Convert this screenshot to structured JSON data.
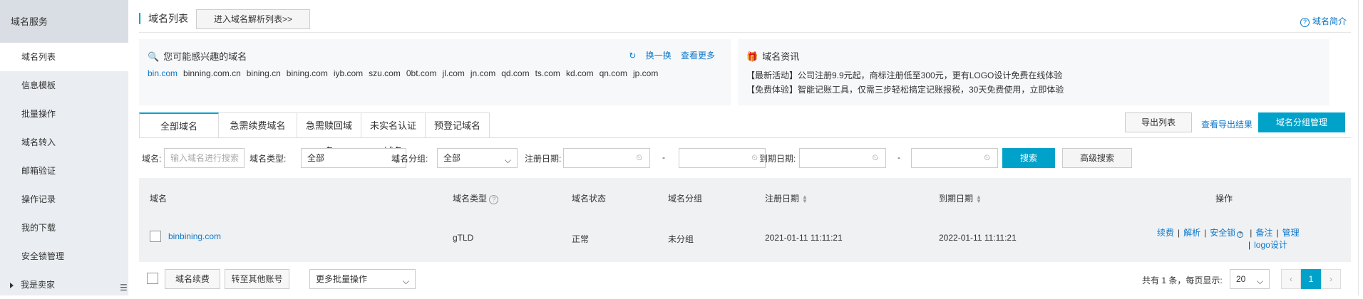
{
  "sidebar": {
    "title": "域名服务",
    "items": [
      {
        "label": "域名列表"
      },
      {
        "label": "信息模板"
      },
      {
        "label": "批量操作"
      },
      {
        "label": "域名转入"
      },
      {
        "label": "邮箱验证"
      },
      {
        "label": "操作记录"
      },
      {
        "label": "我的下载"
      },
      {
        "label": "安全锁管理"
      },
      {
        "label": "我是卖家"
      }
    ]
  },
  "header": {
    "title": "域名列表",
    "goto_label": "进入域名解析列表>>",
    "intro_link": "域名简介"
  },
  "suggest": {
    "title": "您可能感兴趣的域名",
    "refresh": "换一换",
    "more": "查看更多",
    "domains": [
      "bin.com",
      "binning.com.cn",
      "bining.cn",
      "bining.com",
      "iyb.com",
      "szu.com",
      "0bt.com",
      "jl.com",
      "jn.com",
      "qd.com",
      "ts.com",
      "kd.com",
      "qn.com",
      "jp.com"
    ]
  },
  "news": {
    "title": "域名资讯",
    "lines": [
      "【最新活动】公司注册9.9元起，商标注册低至300元，更有LOGO设计免费在线体验",
      "【免费体验】智能记账工具，仅需三步轻松搞定记账报税，30天免费使用，立即体验"
    ]
  },
  "tabs": [
    "全部域名",
    "急需续费域名",
    "急需赎回域名",
    "未实名认证域名",
    "预登记域名"
  ],
  "toolbar": {
    "export": "导出列表",
    "export_result": "查看导出结果",
    "group_manage": "域名分组管理"
  },
  "filter": {
    "domain_label": "域名:",
    "domain_placeholder": "输入域名进行搜索",
    "type_label": "域名类型:",
    "type_value": "全部",
    "group_label": "域名分组:",
    "group_value": "全部",
    "reg_label": "注册日期:",
    "exp_label": "到期日期:",
    "dash": "-",
    "search": "搜索",
    "advanced": "高级搜索"
  },
  "table": {
    "headers": {
      "domain": "域名",
      "type": "域名类型",
      "status": "域名状态",
      "group": "域名分组",
      "reg": "注册日期",
      "exp": "到期日期",
      "ops": "操作"
    },
    "rows": [
      {
        "domain": "binbining.com",
        "type": "gTLD",
        "status": "正常",
        "group": "未分组",
        "reg": "2021-01-11 11:11:21",
        "exp": "2022-01-11 11:11:21",
        "ops": [
          "续费",
          "解析",
          "安全锁",
          "备注",
          "管理",
          "logo设计"
        ]
      }
    ]
  },
  "footer": {
    "renew": "域名续费",
    "transfer": "转至其他账号",
    "batch": "更多批量操作",
    "total": "共有 1 条，每页显示:",
    "page_size": "20",
    "current_page": "1"
  }
}
